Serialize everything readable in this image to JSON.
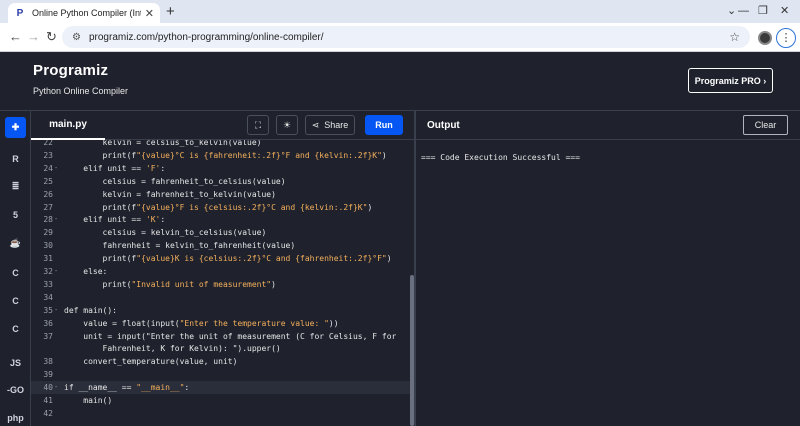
{
  "browser": {
    "tab_title": "Online Python Compiler (Interp",
    "tab_favicon": "P",
    "url": "programiz.com/python-programming/online-compiler/"
  },
  "app": {
    "logo": "Programiz",
    "subtitle": "Python Online Compiler",
    "pro_button": "Programiz PRO ›"
  },
  "rail": [
    {
      "icon": "python-icon",
      "glyph": "✚",
      "active": true
    },
    {
      "icon": "r-icon",
      "glyph": "R",
      "active": false
    },
    {
      "icon": "sql-icon",
      "glyph": "≣",
      "active": false
    },
    {
      "icon": "html-icon",
      "glyph": "5",
      "active": false
    },
    {
      "icon": "java-icon",
      "glyph": "☕",
      "active": false
    },
    {
      "icon": "c-icon",
      "glyph": "C",
      "active": false
    },
    {
      "icon": "cpp-icon",
      "glyph": "C",
      "active": false
    },
    {
      "icon": "csharp-icon",
      "glyph": "C",
      "active": false
    },
    {
      "icon": "js-icon",
      "glyph": "JS",
      "active": false
    },
    {
      "icon": "go-icon",
      "glyph": "-GO",
      "active": false
    },
    {
      "icon": "php-icon",
      "glyph": "php",
      "active": false
    }
  ],
  "editor": {
    "file_tab": "main.py",
    "share_label": "Share",
    "run_label": "Run",
    "lines": [
      {
        "n": "22",
        "fold": "",
        "code": "        kelvin = celsius_to_kelvin(value)"
      },
      {
        "n": "23",
        "fold": "",
        "code": "        print(f\"{value}°C is {fahrenheit:.2f}°F and {kelvin:.2f}K\")"
      },
      {
        "n": "24",
        "fold": "-",
        "code": "    elif unit == 'F':"
      },
      {
        "n": "25",
        "fold": "",
        "code": "        celsius = fahrenheit_to_celsius(value)"
      },
      {
        "n": "26",
        "fold": "",
        "code": "        kelvin = fahrenheit_to_kelvin(value)"
      },
      {
        "n": "27",
        "fold": "",
        "code": "        print(f\"{value}°F is {celsius:.2f}°C and {kelvin:.2f}K\")"
      },
      {
        "n": "28",
        "fold": "-",
        "code": "    elif unit == 'K':"
      },
      {
        "n": "29",
        "fold": "",
        "code": "        celsius = kelvin_to_celsius(value)"
      },
      {
        "n": "30",
        "fold": "",
        "code": "        fahrenheit = kelvin_to_fahrenheit(value)"
      },
      {
        "n": "31",
        "fold": "",
        "code": "        print(f\"{value}K is {celsius:.2f}°C and {fahrenheit:.2f}°F\")"
      },
      {
        "n": "32",
        "fold": "-",
        "code": "    else:"
      },
      {
        "n": "33",
        "fold": "",
        "code": "        print(\"Invalid unit of measurement\")"
      },
      {
        "n": "34",
        "fold": "",
        "code": ""
      },
      {
        "n": "35",
        "fold": "-",
        "code": "def main():"
      },
      {
        "n": "36",
        "fold": "",
        "code": "    value = float(input(\"Enter the temperature value: \"))"
      },
      {
        "n": "37",
        "fold": "",
        "code": "    unit = input(\"Enter the unit of measurement (C for Celsius, F for"
      },
      {
        "n": "",
        "fold": "",
        "code": "        Fahrenheit, K for Kelvin): \").upper()"
      },
      {
        "n": "38",
        "fold": "",
        "code": "    convert_temperature(value, unit)"
      },
      {
        "n": "39",
        "fold": "",
        "code": ""
      },
      {
        "n": "40",
        "fold": "-",
        "code": "if __name__ == \"__main__\":"
      },
      {
        "n": "41",
        "fold": "",
        "code": "    main()"
      },
      {
        "n": "42",
        "fold": "",
        "code": ""
      }
    ]
  },
  "output": {
    "label": "Output",
    "clear_label": "Clear",
    "text": "=== Code Execution Successful ==="
  }
}
